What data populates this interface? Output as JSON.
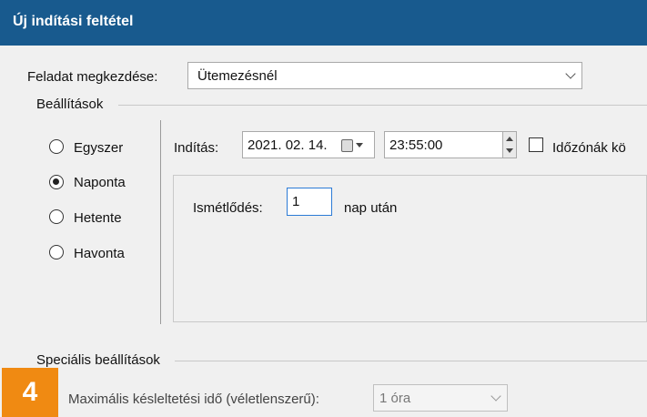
{
  "window": {
    "title": "Új indítási feltétel"
  },
  "task_start": {
    "label": "Feladat megkezdése:",
    "value": "Ütemezésnél"
  },
  "settings": {
    "group_title": "Beállítások",
    "schedule_options": [
      {
        "label": "Egyszer",
        "selected": false
      },
      {
        "label": "Naponta",
        "selected": true
      },
      {
        "label": "Hetente",
        "selected": false
      },
      {
        "label": "Havonta",
        "selected": false
      }
    ],
    "start": {
      "label": "Indítás:",
      "date": "2021. 02. 14.",
      "time": "23:55:00",
      "timezone_label": "Időzónák kö"
    },
    "repeat": {
      "label": "Ismétlődés:",
      "value": "1",
      "suffix": "nap után"
    }
  },
  "special": {
    "group_title": "Speciális beállítások",
    "max_delay_label": "Maximális késleltetési idő (véletlenszerű):",
    "max_delay_value": "1 óra"
  },
  "badge": {
    "number": "4",
    "color": "#f08a12"
  }
}
